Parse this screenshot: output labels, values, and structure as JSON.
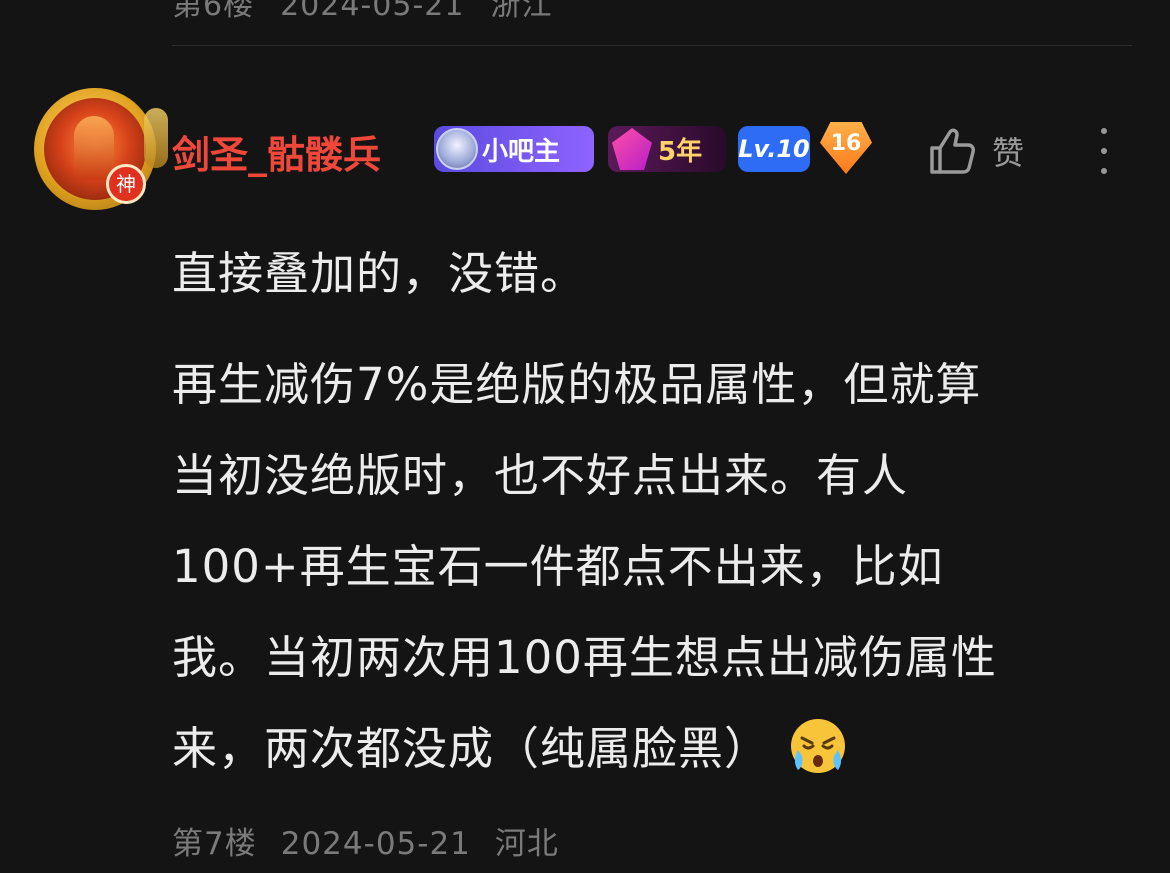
{
  "previous_post": {
    "floor": "第6楼",
    "date": "2024-05-21",
    "location": "浙江"
  },
  "post": {
    "username": "剑圣_骷髅兵",
    "avatar_badge": "神",
    "badges": {
      "admin": "小吧主",
      "years": "5年",
      "level": "Lv.10",
      "rank": "16"
    },
    "like_label": "赞",
    "paragraphs": [
      [
        "直接叠加的，没错。"
      ],
      [
        "再生减伤7%是绝版的极品属性，但就算",
        "当初没绝版时，也不好点出来。有人",
        "100+再生宝石一件都点不出来，比如",
        "我。当初两次用100再生想点出减伤属性",
        "来，两次都没成（纯属脸黑）"
      ]
    ],
    "floor": "第7楼",
    "date": "2024-05-21",
    "location": "河北"
  },
  "colors": {
    "background": "#141414",
    "username": "#f0473b",
    "text": "#ececec",
    "meta": "#7a7a7a"
  }
}
